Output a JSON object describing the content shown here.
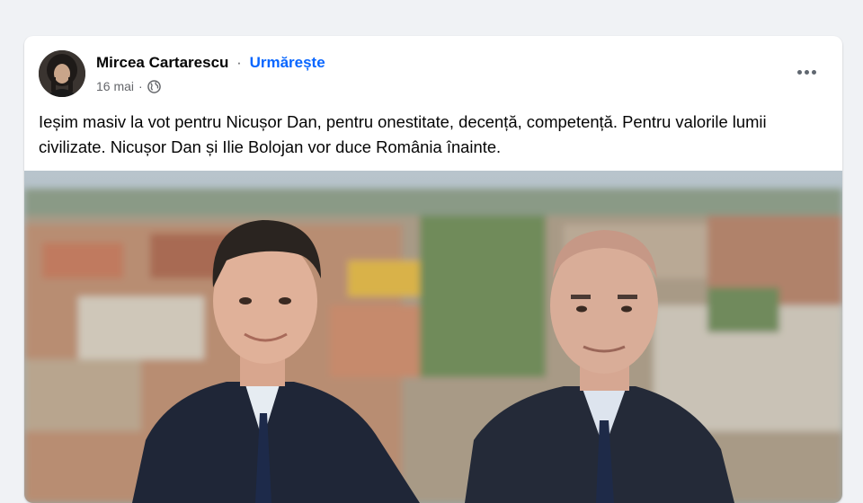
{
  "post": {
    "author": "Mircea Cartarescu",
    "separator": "·",
    "follow_label": "Urmărește",
    "date": "16 mai",
    "meta_separator": "·",
    "privacy_icon": "globe-icon",
    "more_icon": "more-options-icon",
    "text": "Ieșim masiv la vot pentru Nicușor Dan, pentru onestitate, decență, competență. Pentru valorile lumii civilizate. Nicușor Dan și Ilie Bolojan vor duce România înainte.",
    "image": {
      "subject": "Two men in dark suits in front of a blurred aerial city view"
    }
  },
  "colors": {
    "page_background": "#f0f2f5",
    "card_background": "#ffffff",
    "link_blue": "#0866ff",
    "secondary_text": "#65676b"
  }
}
